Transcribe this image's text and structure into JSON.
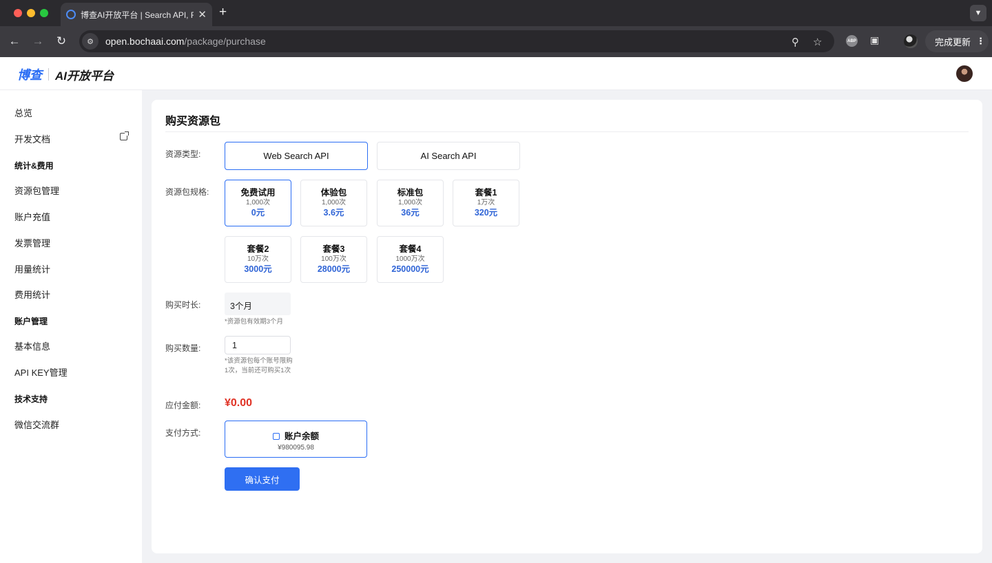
{
  "browser": {
    "tab_title": "博查AI开放平台 | Search API, F",
    "tab_close": "✕",
    "new_tab": "+",
    "url_host": "open.bochaai.com",
    "url_path": "/package/purchase",
    "update_label": "完成更新",
    "abp_label": "ABP"
  },
  "app": {
    "logo_mark": "博查",
    "logo_text": "AI开放平台"
  },
  "sidebar": {
    "overview": "总览",
    "docs": "开发文档",
    "group_stats": "统计&费用",
    "package_mgmt": "资源包管理",
    "recharge": "账户充值",
    "invoice": "发票管理",
    "usage_stats": "用量统计",
    "cost_stats": "费用统计",
    "group_account": "账户管理",
    "basic_info": "基本信息",
    "api_key": "API KEY管理",
    "group_support": "技术支持",
    "wechat_group": "微信交流群"
  },
  "purchase": {
    "title": "购买资源包",
    "type_label": "资源类型:",
    "types": [
      "Web Search API",
      "AI Search API"
    ],
    "spec_label": "资源包规格:",
    "packages": [
      {
        "name": "免费试用",
        "count": "1,000次",
        "price": "0元"
      },
      {
        "name": "体验包",
        "count": "1,000次",
        "price": "3.6元"
      },
      {
        "name": "标准包",
        "count": "1,000次",
        "price": "36元"
      },
      {
        "name": "套餐1",
        "count": "1万次",
        "price": "320元"
      },
      {
        "name": "套餐2",
        "count": "10万次",
        "price": "3000元"
      },
      {
        "name": "套餐3",
        "count": "100万次",
        "price": "28000元"
      },
      {
        "name": "套餐4",
        "count": "1000万次",
        "price": "250000元"
      }
    ],
    "duration_label": "购买时长:",
    "duration_value": "3个月",
    "duration_hint": "*资源包有效期3个月",
    "quantity_label": "购买数量:",
    "quantity_value": "1",
    "quantity_hint": "*该资源包每个账号限购1次，当前还可购买1次",
    "amount_label": "应付金额:",
    "amount_value": "¥0.00",
    "payment_label": "支付方式:",
    "payment_method": "账户余额",
    "payment_balance": "¥980095.98",
    "confirm_button": "确认支付"
  }
}
